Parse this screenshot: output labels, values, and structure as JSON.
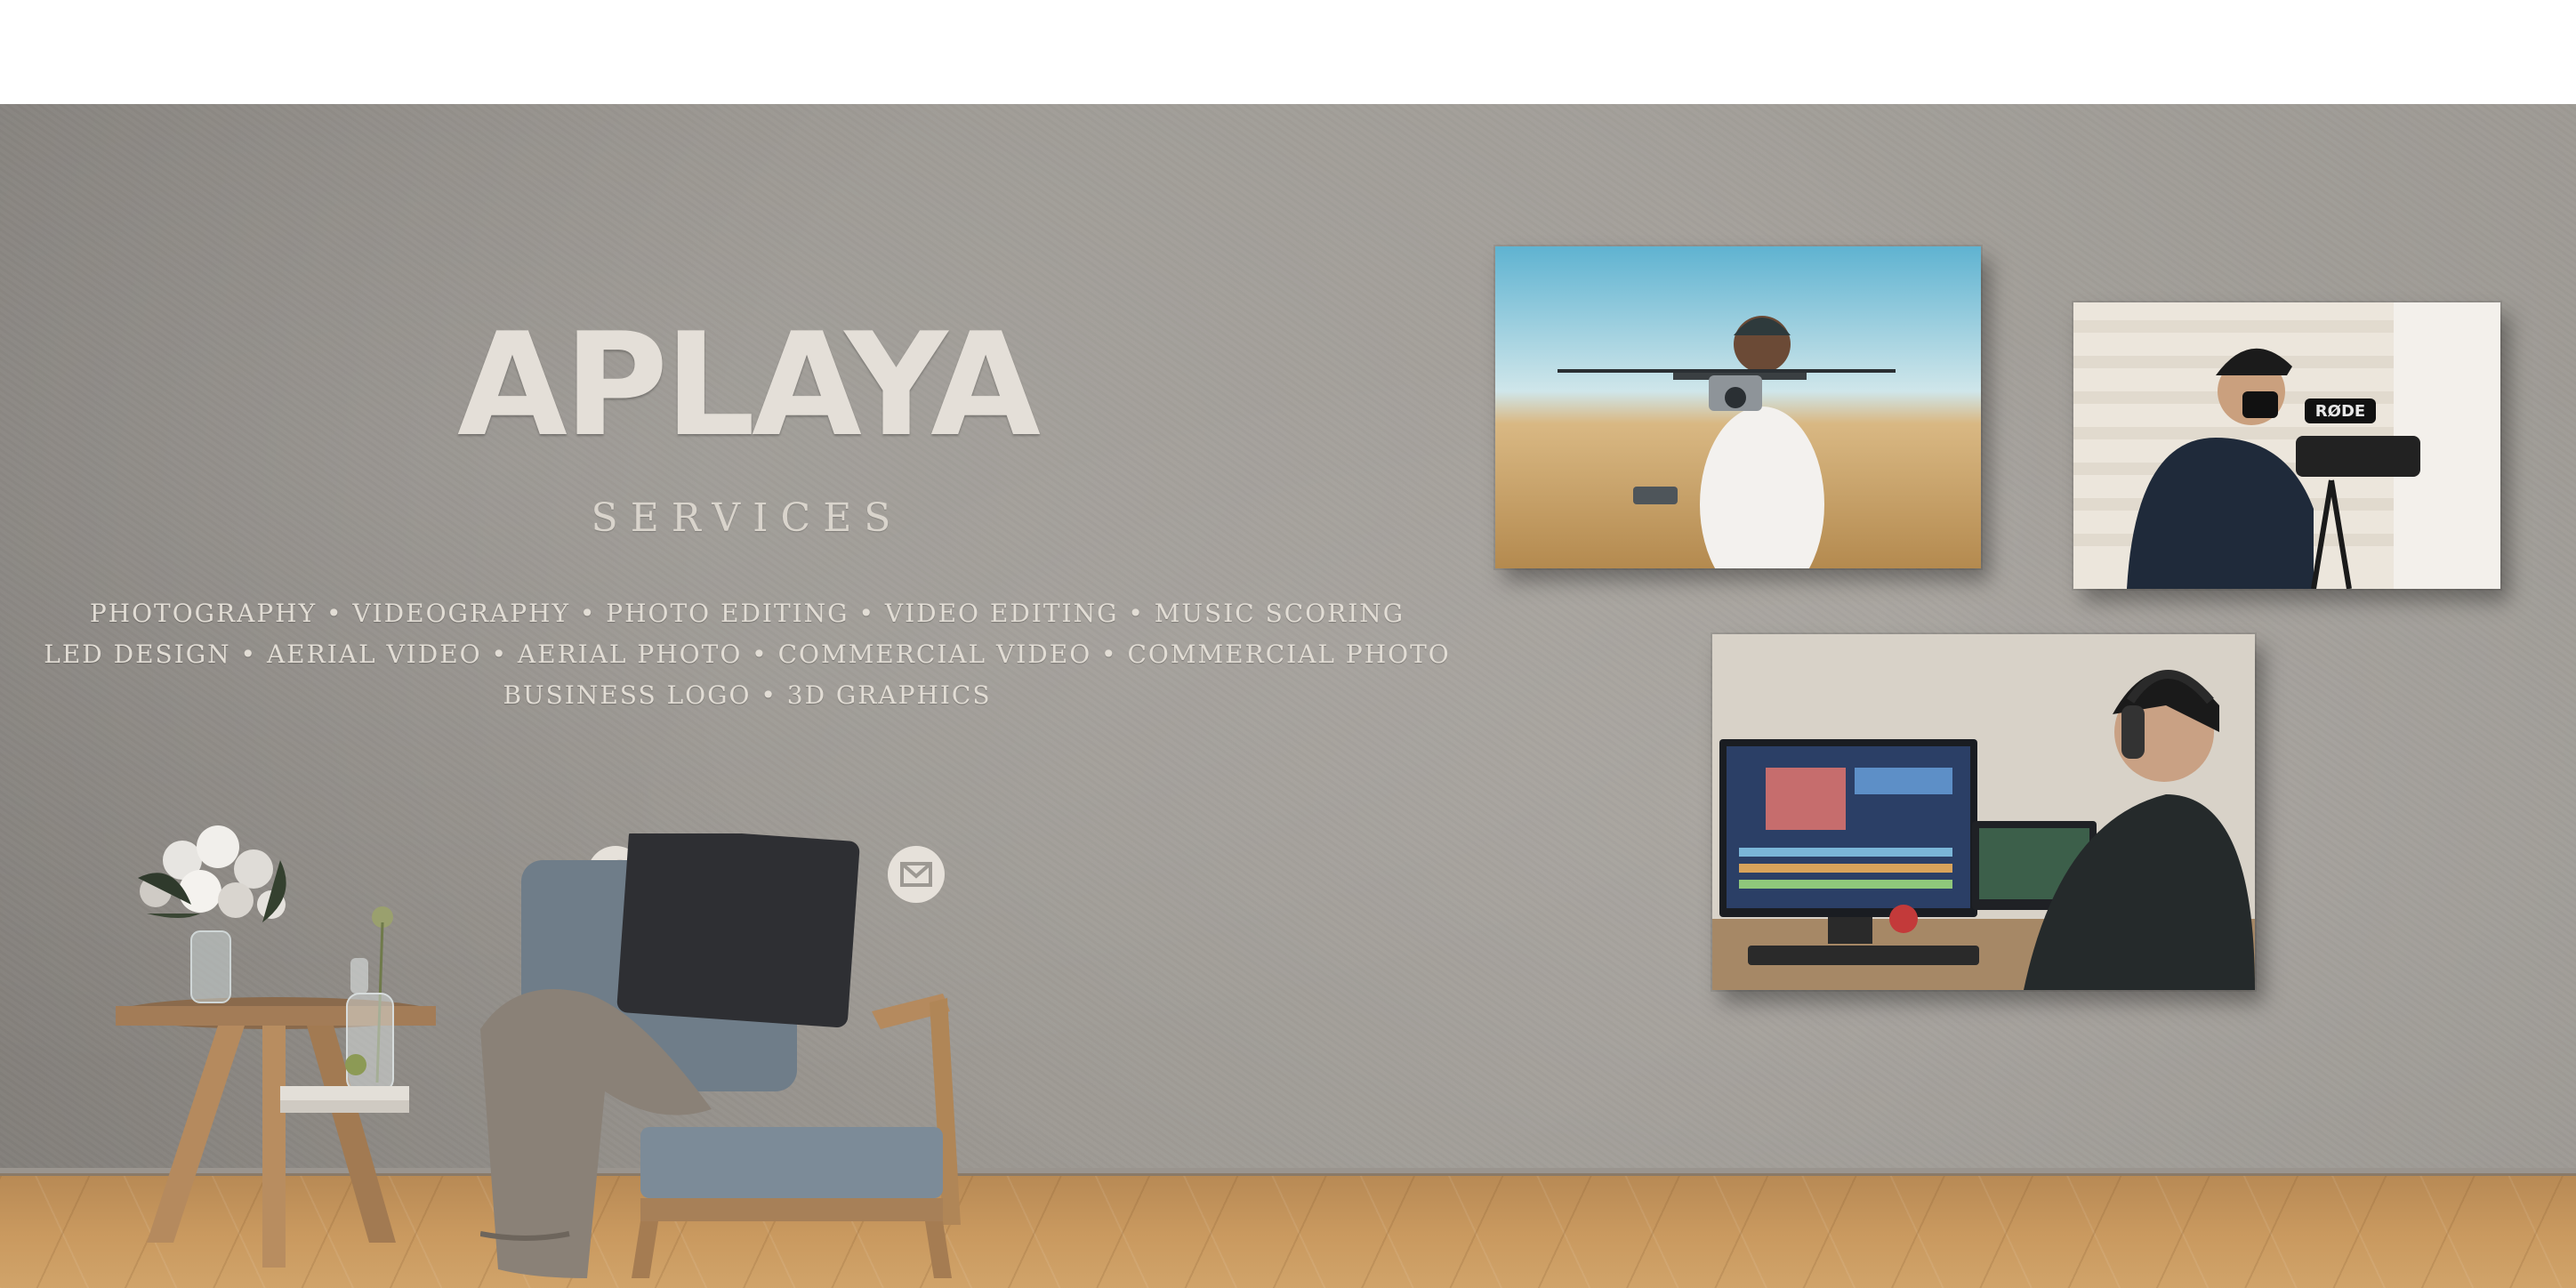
{
  "brand": {
    "logo_text": "APLAYA"
  },
  "services": {
    "heading": "SERVICES",
    "lines": [
      "PHOTOGRAPHY • VIDEOGRAPHY • PHOTO EDITING • VIDEO EDITING • MUSIC SCORING",
      "LED DESIGN • AERIAL VIDEO • AERIAL PHOTO • COMMERCIAL VIDEO • COMMERCIAL PHOTO",
      "BUSINESS LOGO • 3D GRAPHICS"
    ]
  },
  "social_links": [
    {
      "icon": "facebook-icon"
    },
    {
      "icon": "instagram-icon"
    },
    {
      "icon": "gmail-icon"
    }
  ],
  "gallery": [
    {
      "subject": "drone-pilot-photo"
    },
    {
      "subject": "videographer-camera-photo"
    },
    {
      "subject": "video-editor-workstation-photo",
      "brand_text": "RØDE"
    }
  ],
  "colors": {
    "wall": "#9d9993",
    "floor": "#c9995f",
    "text": "#e2ddd5",
    "icon": "#e6e1da"
  }
}
